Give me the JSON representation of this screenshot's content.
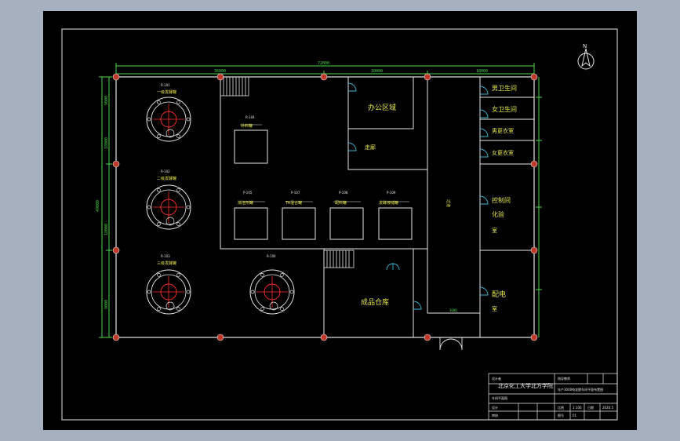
{
  "colors": {
    "background": "#a6b0be",
    "sheet": "#000000",
    "wall": "#e6e6e6",
    "dimension": "#4cd64c",
    "label": "#e8e84a",
    "door": "#3fb8d8",
    "column": "#c0392b",
    "axis": "#ff3030"
  },
  "dimensions": {
    "total": "72000",
    "seg1": "36000",
    "seg2": "18000",
    "seg3": "18000",
    "left_total": "49000",
    "left_seg1": "9000",
    "left_seg2": "18000",
    "left_seg3": "18000",
    "left_seg4": "9000",
    "door_width": "3000"
  },
  "rooms": {
    "office": "办公区域",
    "walkway": "走廊",
    "corridor": "过道",
    "mens_wc": "男卫生间",
    "womens_wc": "女卫生间",
    "changing_m": "男更衣室",
    "changing_f": "女更衣室",
    "control_room": "控制间",
    "control_sub": "化验",
    "control_room2": "室",
    "power_room": "配电",
    "power_room2": "室",
    "warehouse": "成品仓库"
  },
  "equipment": {
    "r101": {
      "tag": "R-101",
      "name": "一级发酵罐"
    },
    "r102": {
      "tag": "R-102",
      "name": "二级发酵罐"
    },
    "r103": {
      "tag": "R-103",
      "name": "三级发酵罐"
    },
    "r104": {
      "tag": "R-104",
      "name": "补料罐"
    },
    "p104": {
      "tag": "P-104",
      "name": "空气过滤器"
    },
    "p105": {
      "tag": "P-105",
      "name": "消泡剂罐"
    },
    "p107": {
      "tag": "P-107",
      "name": "TA混合罐"
    },
    "p108": {
      "tag": "P-108",
      "name": "配料罐"
    },
    "p109": {
      "tag": "P-109",
      "name": "发酵液储罐"
    }
  },
  "title_block": {
    "school": "北京化工大学北方学院",
    "drawing_name": "年产3000吨发酵车间平面布置图",
    "drawn_by": "设计",
    "checked_by": "审核",
    "scale_label": "比例",
    "scale_value": "1:100",
    "sheet_label": "图号",
    "sheet_value": "01",
    "date_label": "日期",
    "date_value": "2020.5",
    "field_a": "设计者",
    "field_b": "指导教师",
    "field_c": "车间平面图"
  },
  "north_arrow": "N"
}
